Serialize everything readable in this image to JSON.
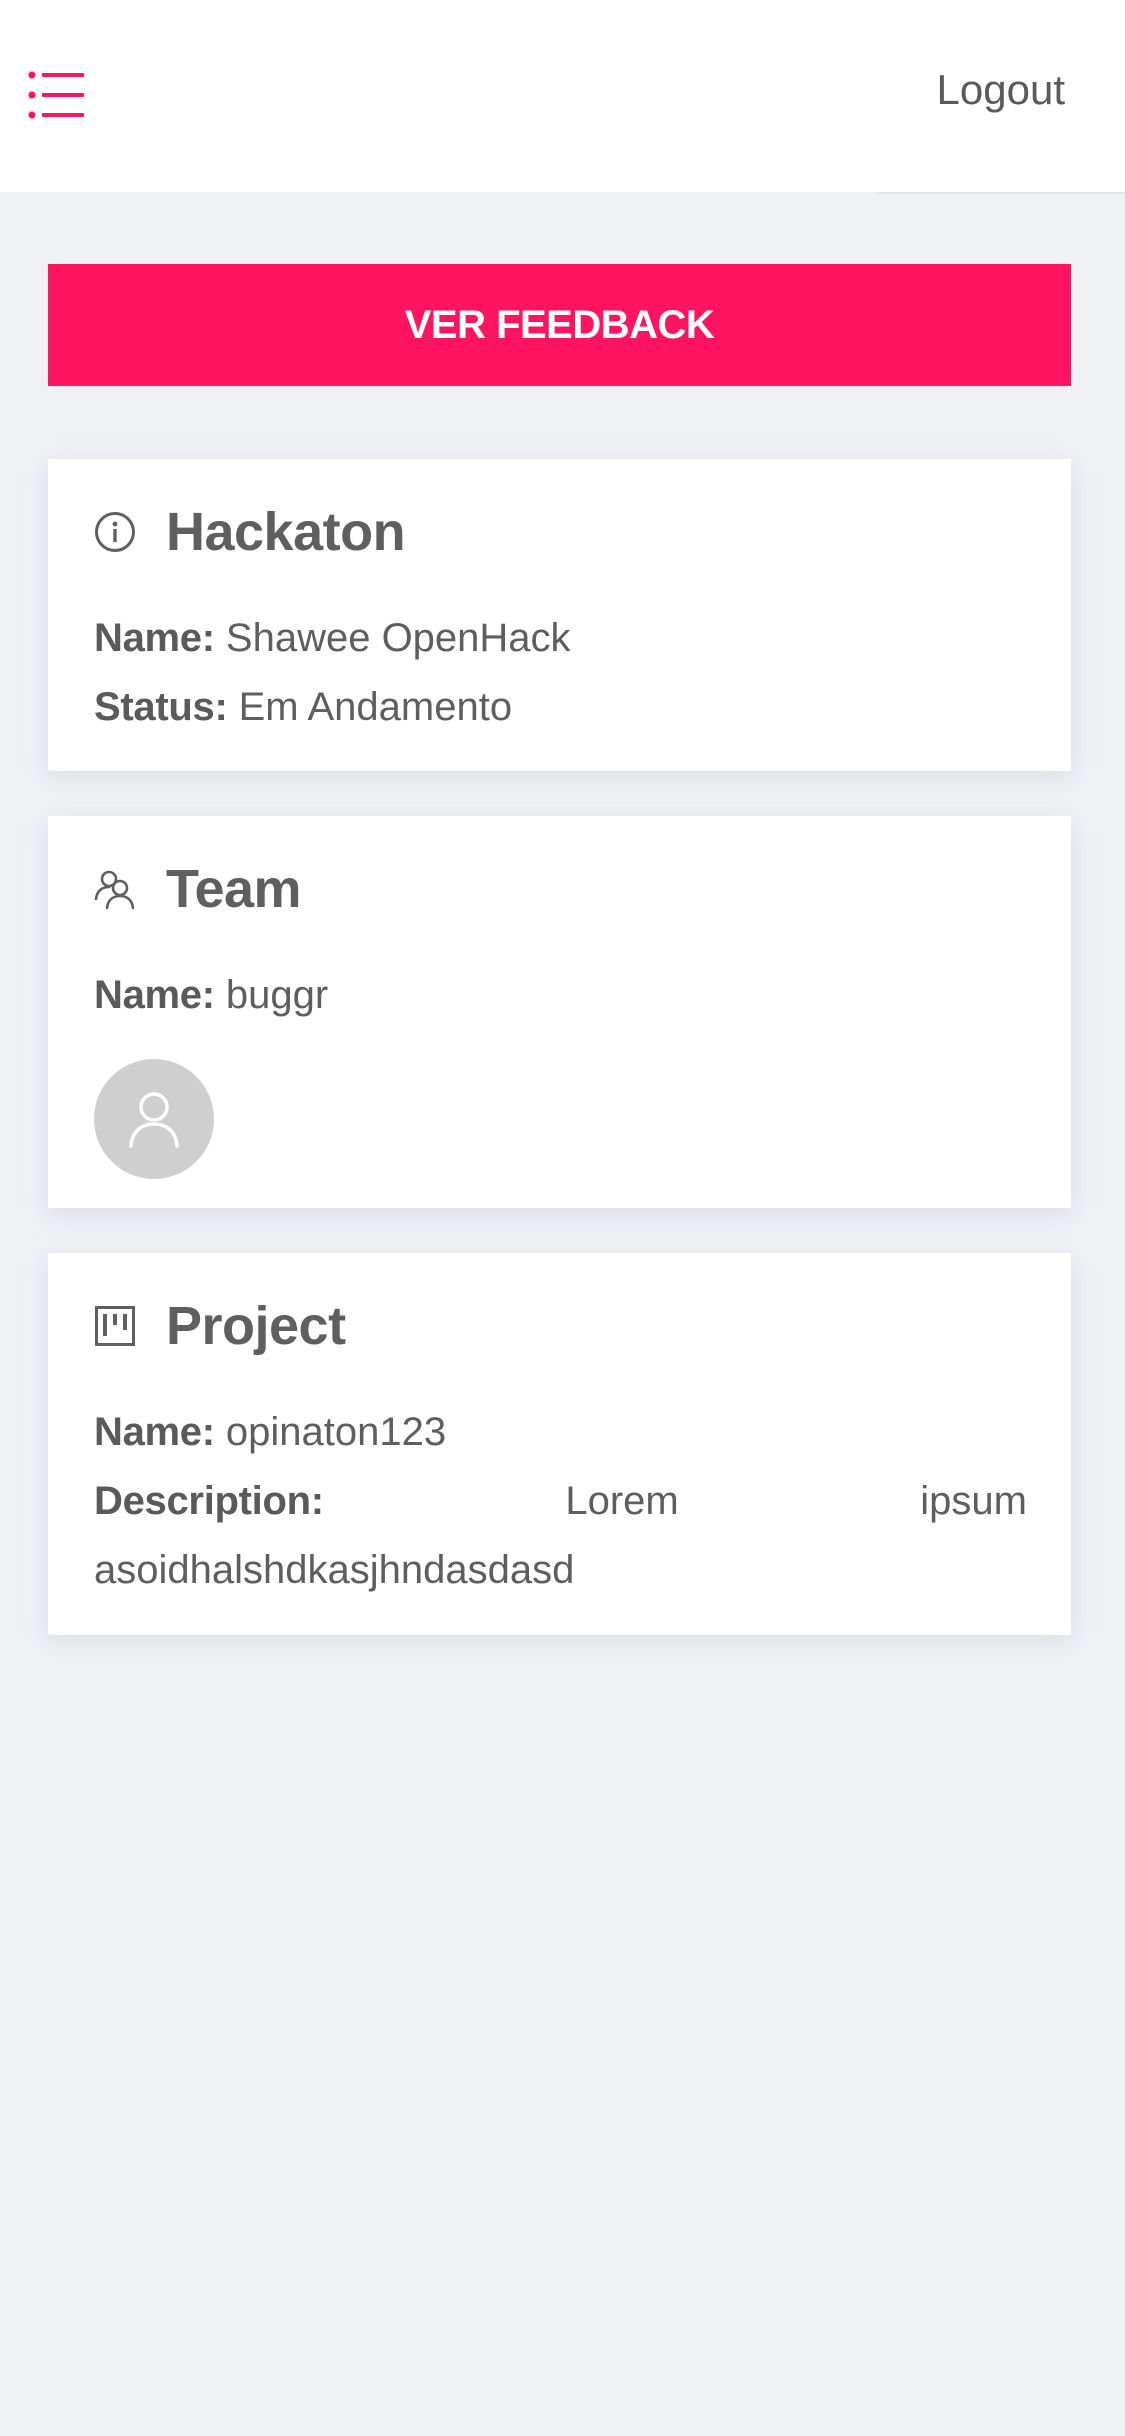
{
  "header": {
    "logout_label": "Logout",
    "menu_icon": "list-icon",
    "accent_color": "#ff1462"
  },
  "feedback_button": {
    "label": "VER FEEDBACK"
  },
  "hackaton": {
    "icon": "info-icon",
    "title": "Hackaton",
    "name_label": "Name:",
    "name_value": "Shawee OpenHack",
    "status_label": "Status:",
    "status_value": "Em Andamento"
  },
  "team": {
    "icon": "team-icon",
    "title": "Team",
    "name_label": "Name:",
    "name_value": "buggr",
    "member_avatar_icon": "user-icon"
  },
  "project": {
    "icon": "board-icon",
    "title": "Project",
    "name_label": "Name:",
    "name_value": "opinaton123",
    "description_label": "Description:",
    "description_value": "Lorem ipsum asoidhalshdkasjhndasdasd"
  }
}
